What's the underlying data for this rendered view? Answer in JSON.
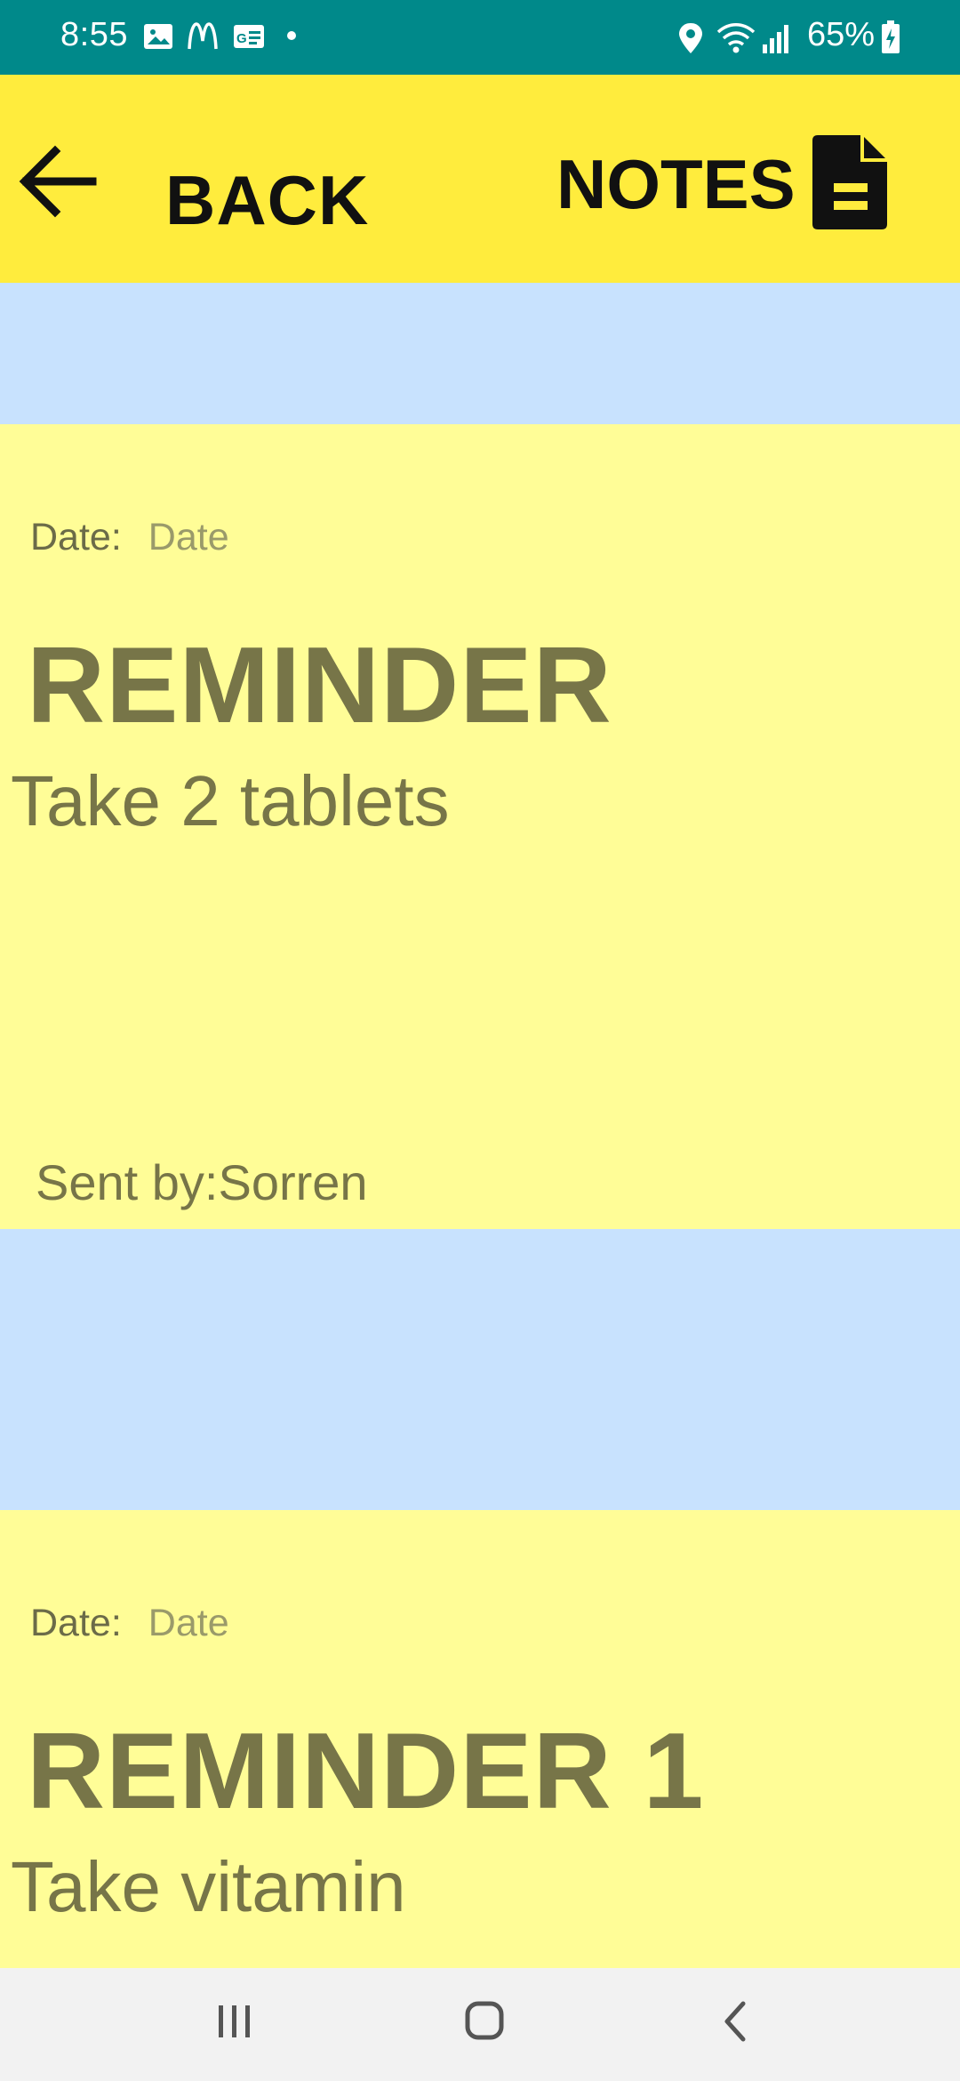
{
  "status_bar": {
    "time": "8:55",
    "battery": "65%",
    "icons": [
      "gallery-icon",
      "mcdonalds-icon",
      "card-icon",
      "dot-icon",
      "location-icon",
      "wifi-icon",
      "signal-icon",
      "battery-icon"
    ]
  },
  "app_bar": {
    "back_label": "BACK",
    "title": "NOTES",
    "icons": [
      "back-arrow-icon",
      "document-icon"
    ]
  },
  "notes": [
    {
      "date_label": "Date:",
      "date_value": "Date",
      "title": "REMINDER",
      "body": "Take 2 tablets",
      "sent_by": "Sent by:Sorren"
    },
    {
      "date_label": "Date:",
      "date_value": "Date",
      "title": "REMINDER 1",
      "body": "Take vitamin"
    }
  ],
  "nav_bar": {
    "icons": [
      "recent-apps-icon",
      "home-icon",
      "back-icon"
    ]
  },
  "colors": {
    "status_bar": "#00898a",
    "app_bar": "#ffec3d",
    "background": "#c8e2fe",
    "note_card": "#fffd97",
    "note_text": "#777548"
  }
}
